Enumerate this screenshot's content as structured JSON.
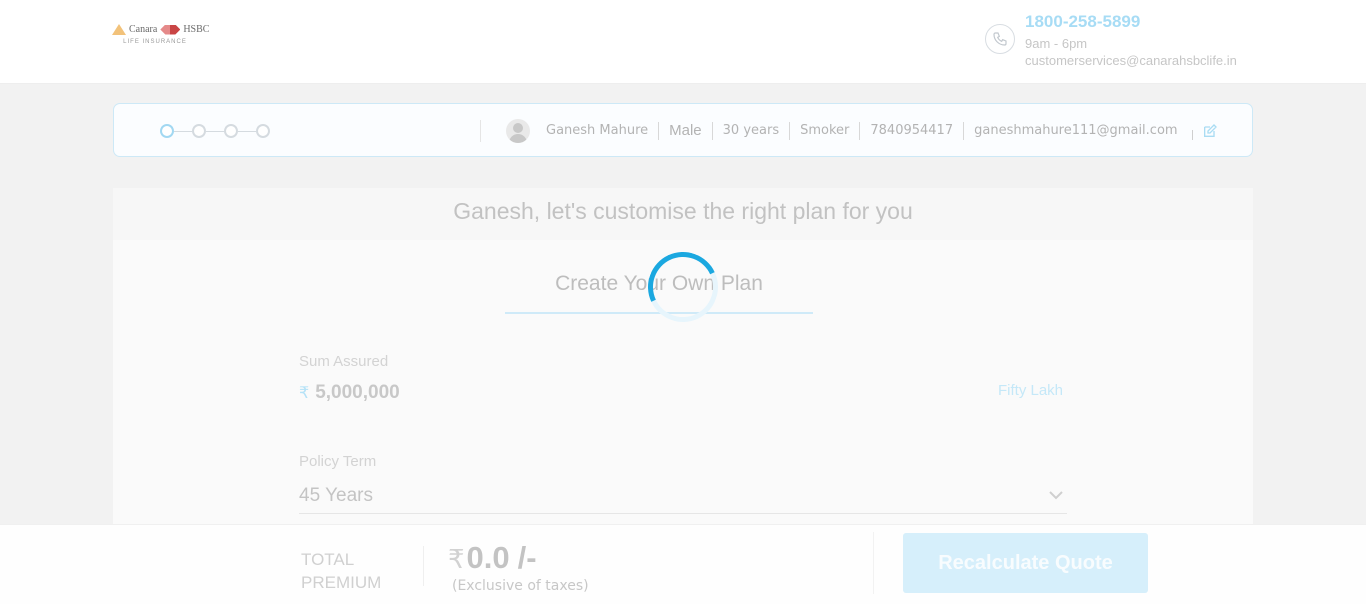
{
  "header": {
    "logo": {
      "brand_left": "Canara",
      "brand_right": "HSBC",
      "subtitle": "LIFE INSURANCE"
    },
    "contact": {
      "phone": "1800-258-5899",
      "hours": "9am - 6pm",
      "email": "customerservices@canarahsbclife.in",
      "icon": "phone-icon"
    }
  },
  "summary": {
    "steps_total": 4,
    "active_step": 1,
    "name": "Ganesh Mahure",
    "gender": "Male",
    "age": "30 years",
    "smoker": "Smoker",
    "phone": "7840954417",
    "email": "ganeshmahure111@gmail.com",
    "edit_icon": "edit-icon"
  },
  "main": {
    "title": "Ganesh, let's customise the right plan for you",
    "tab_label": "Create Your Own Plan",
    "sum_assured": {
      "label": "Sum Assured",
      "currency_symbol": "₹",
      "value": "5,000,000",
      "words": "Fifty Lakh"
    },
    "policy_term": {
      "label": "Policy Term",
      "value": "45 Years"
    }
  },
  "bottom": {
    "total_label_line1": "TOTAL",
    "total_label_line2": "PREMIUM",
    "currency_symbol": "₹",
    "amount": "0.0",
    "suffix": "/-",
    "tax_note": "(Exclusive of taxes)",
    "button_label": "Recalculate Quote"
  },
  "colors": {
    "accent": "#1ba8e0",
    "accent_light": "#a7dcf5"
  }
}
